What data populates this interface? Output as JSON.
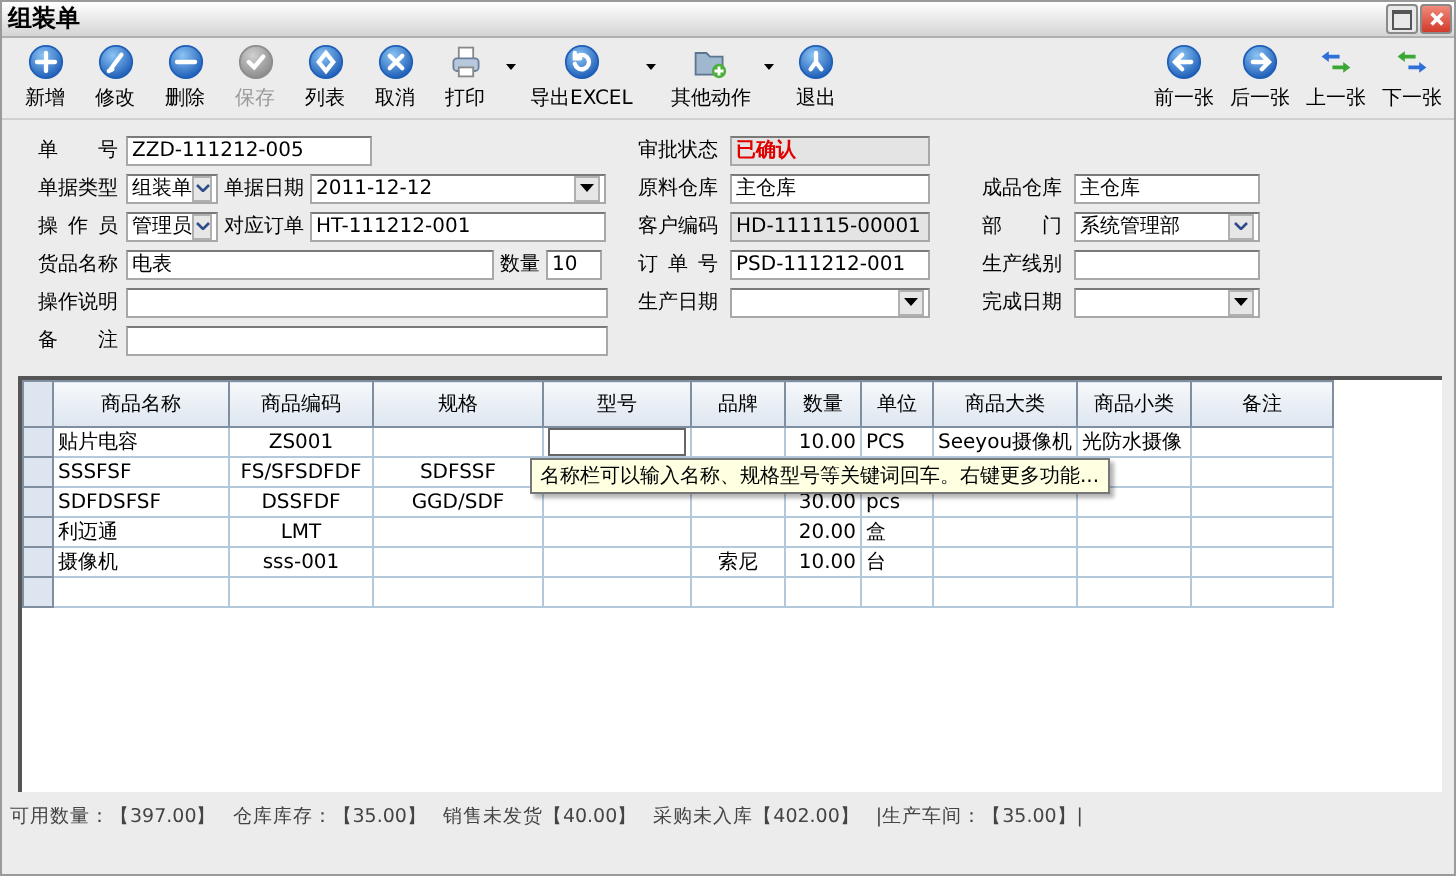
{
  "window": {
    "title": "组装单"
  },
  "toolbar": [
    {
      "label": "新增",
      "kind": "plus",
      "disabled": false,
      "dropdown": false
    },
    {
      "label": "修改",
      "kind": "edit",
      "disabled": false,
      "dropdown": false
    },
    {
      "label": "删除",
      "kind": "minus",
      "disabled": false,
      "dropdown": false
    },
    {
      "label": "保存",
      "kind": "check",
      "disabled": true,
      "dropdown": false
    },
    {
      "label": "列表",
      "kind": "list",
      "disabled": false,
      "dropdown": false
    },
    {
      "label": "取消",
      "kind": "close",
      "disabled": false,
      "dropdown": false
    },
    {
      "label": "打印",
      "kind": "print",
      "disabled": false,
      "dropdown": true
    },
    {
      "label": "导出EXCEL",
      "kind": "refresh",
      "disabled": false,
      "dropdown": true
    },
    {
      "label": "其他动作",
      "kind": "folder",
      "disabled": false,
      "dropdown": true
    },
    {
      "label": "退出",
      "kind": "exit",
      "disabled": false,
      "dropdown": false
    }
  ],
  "nav": [
    {
      "label": "前一张",
      "kind": "left"
    },
    {
      "label": "后一张",
      "kind": "right"
    },
    {
      "label": "上一张",
      "kind": "swap-up"
    },
    {
      "label": "下一张",
      "kind": "swap-down"
    }
  ],
  "form_rows": [
    {
      "left": [
        {
          "label": "单 号",
          "kind": "text",
          "value": "ZZD-111212-005"
        }
      ],
      "middle": {
        "label": "审批状态",
        "kind": "status",
        "value": "已确认"
      }
    },
    {
      "left": [
        {
          "label": "单据类型",
          "kind": "select",
          "value": "组装单"
        },
        {
          "label": "单据日期",
          "kind": "date",
          "value": "2011-12-12"
        }
      ],
      "middle": {
        "label": "原料仓库",
        "kind": "text",
        "value": "主仓库"
      },
      "right": {
        "label": "成品仓库",
        "kind": "text",
        "value": "主仓库"
      }
    },
    {
      "left": [
        {
          "label": "操 作 员",
          "kind": "select",
          "value": "管理员"
        },
        {
          "label": "对应订单",
          "kind": "text",
          "value": "HT-111212-001"
        }
      ],
      "middle": {
        "label": "客户编码",
        "kind": "readonly",
        "value": "HD-111115-00001"
      },
      "right": {
        "label": "部 门",
        "kind": "select",
        "value": "系统管理部"
      }
    },
    {
      "left": [
        {
          "label": "货品名称",
          "kind": "text",
          "value": "电表"
        },
        {
          "label": "数量",
          "kind": "text",
          "value": "10"
        }
      ],
      "middle": {
        "label": "订 单 号",
        "kind": "text",
        "value": "PSD-111212-001"
      },
      "right": {
        "label": "生产线别",
        "kind": "text"
      }
    },
    {
      "left": [
        {
          "label": "操作说明",
          "kind": "text"
        }
      ],
      "middle": {
        "label": "生产日期",
        "kind": "date"
      },
      "right": {
        "label": "完成日期",
        "kind": "date"
      }
    },
    {
      "left": [
        {
          "label": "备 注",
          "kind": "text"
        }
      ]
    }
  ],
  "table": {
    "columns": [
      "商品名称",
      "商品编码",
      "规格",
      "型号",
      "品牌",
      "数量",
      "单位",
      "商品大类",
      "商品小类",
      "备注"
    ],
    "rows": [
      {
        "editing": true,
        "cells": [
          "贴片电容",
          "ZS001",
          null,
          null,
          null,
          "10.00",
          "PCS",
          "Seeyou摄像机",
          "光防水摄像",
          null
        ]
      },
      {
        "editing": false,
        "cells": [
          "SSSFSF",
          "FS/SFSDFDF",
          "SDFSSF",
          null,
          null,
          null,
          null,
          null,
          null,
          null
        ]
      },
      {
        "editing": false,
        "cells": [
          "SDFDSFSF",
          "DSSFDF",
          "GGD/SDF",
          null,
          null,
          "30.00",
          "pcs",
          null,
          null,
          null
        ]
      },
      {
        "editing": false,
        "cells": [
          "利迈通",
          "LMT",
          null,
          null,
          null,
          "20.00",
          "盒",
          null,
          null,
          null
        ]
      },
      {
        "editing": false,
        "cells": [
          "摄像机",
          "sss-001",
          null,
          null,
          "索尼",
          "10.00",
          "台",
          null,
          null,
          null
        ]
      },
      {
        "editing": false,
        "cells": [
          null,
          null,
          null,
          null,
          null,
          null,
          null,
          null,
          null,
          null
        ]
      }
    ],
    "tooltip": "名称栏可以输入名称、规格型号等关键词回车。右键更多功能..."
  },
  "status_bar": [
    "可用数量：【397.00】",
    "仓库库存：【35.00】",
    "销售未发货【40.00】",
    "采购未入库【402.00】",
    "|生产车间：【35.00】|"
  ]
}
